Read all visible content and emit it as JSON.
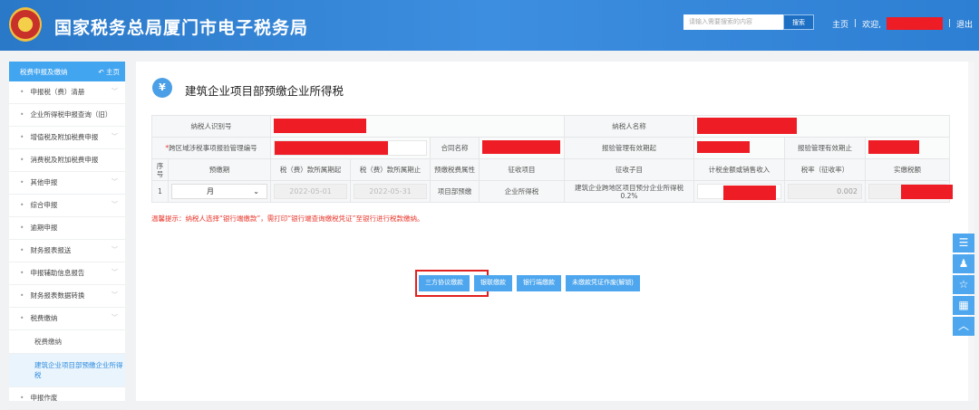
{
  "header": {
    "title": "国家税务总局厦门市电子税务局",
    "search_placeholder": "请输入需要搜索的内容",
    "search_button": "搜索",
    "home": "主页",
    "welcome": "欢迎,",
    "logout": "退出",
    "separator": "|"
  },
  "sidebar": {
    "heading": "税费申报及缴纳",
    "home_link": "主页",
    "items": [
      {
        "label": "申报税（费）清册",
        "expandable": true
      },
      {
        "label": "企业所得税申报查询（旧）",
        "expandable": false
      },
      {
        "label": "增值税及附加税费申报",
        "expandable": true
      },
      {
        "label": "消费税及附加税费申报",
        "expandable": false
      },
      {
        "label": "其他申报",
        "expandable": true
      },
      {
        "label": "综合申报",
        "expandable": true
      },
      {
        "label": "逾期申报",
        "expandable": false
      },
      {
        "label": "财务报表报送",
        "expandable": true
      },
      {
        "label": "申报辅助信息报告",
        "expandable": true
      },
      {
        "label": "财务报表数据转换",
        "expandable": true
      },
      {
        "label": "税费缴纳",
        "expandable": true
      }
    ],
    "subitems": [
      {
        "label": "税费缴纳"
      },
      {
        "label": "建筑企业项目部预缴企业所得税",
        "active": true
      }
    ],
    "last_item": "申报作废"
  },
  "page": {
    "title": "建筑企业项目部预缴企业所得税",
    "icon": "¥"
  },
  "form": {
    "taxpayer_id_label": "纳税人识别号",
    "taxpayer_name_label": "纳税人名称",
    "mgmt_no_label": "跨区域涉税事项报验管理编号",
    "required_mark": "*",
    "contract_label": "合同名称",
    "valid_from_label": "报验管理有效期起",
    "valid_to_label": "报验管理有效期止",
    "columns": [
      "序号",
      "预缴期",
      "税（费）款所属期起",
      "税（费）款所属期止",
      "预缴税费属性",
      "征收项目",
      "征收子目",
      "计税金额或销售收入",
      "税率（征收率）",
      "实缴税额"
    ],
    "row": {
      "index": "1",
      "period": "月",
      "start": "2022-05-01",
      "end": "2022-05-31",
      "attribute": "项目部预缴",
      "item": "企业所得税",
      "subitem": "建筑企业跨地区项目预分企业所得税0.2%",
      "rate": "0.002"
    }
  },
  "notice": "温馨提示：纳税人选择“银行端缴款”，需打印“银行端查询缴税凭证”至银行进行税款缴纳。",
  "buttons": [
    "三方协议缴款",
    "银联缴款",
    "银行端缴款",
    "未缴款凭证作废(解锁)"
  ],
  "float_icons": [
    "form-icon",
    "user-icon",
    "star-icon",
    "calculator-icon",
    "up-icon"
  ]
}
